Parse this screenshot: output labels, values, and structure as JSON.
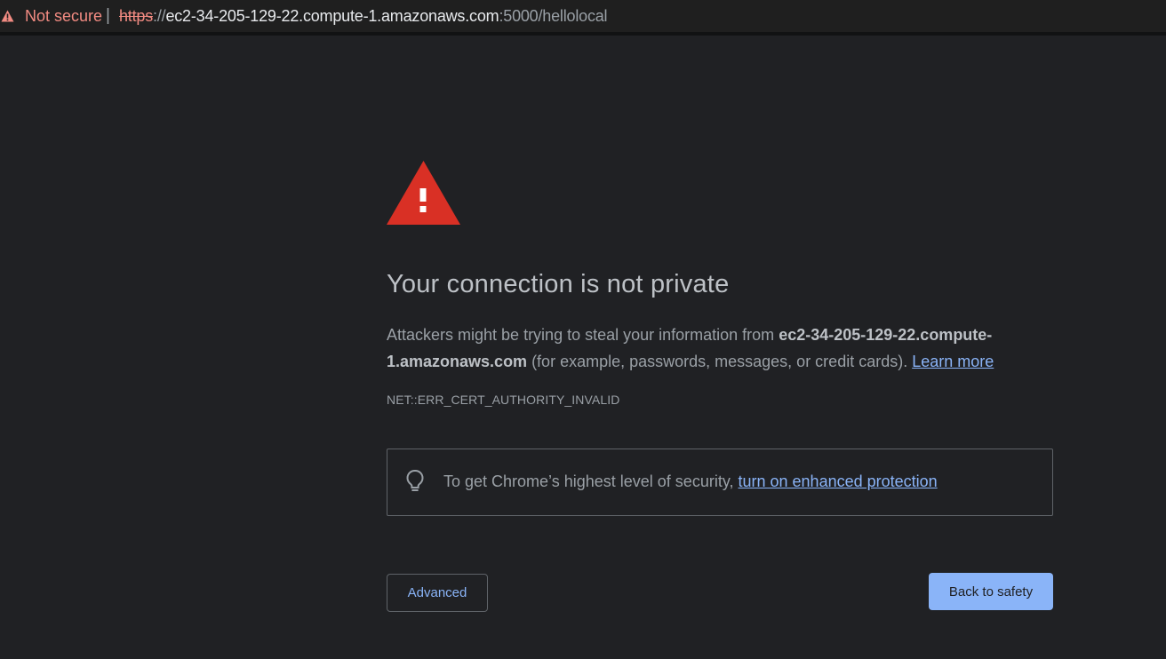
{
  "addressbar": {
    "security_label": "Not secure",
    "separator": "|",
    "url_scheme": "https",
    "url_separator": "://",
    "url_host": "ec2-34-205-129-22.compute-1.amazonaws.com",
    "url_rest": ":5000/hellolocal",
    "warning_icon": "warning-triangle-icon",
    "warning_color": "#f28b82"
  },
  "interstitial": {
    "danger_icon": "danger-triangle-icon",
    "danger_color": "#d93025",
    "heading": "Your connection is not private",
    "explanation_prefix": "Attackers might be trying to steal your information from ",
    "explanation_host": "ec2-34-205-129-22.compute-1.amazonaws.com",
    "explanation_suffix": " (for example, passwords, messages, or credit cards). ",
    "learn_more_link": "Learn more",
    "error_code": "NET::ERR_CERT_AUTHORITY_INVALID",
    "enhanced_protection": {
      "icon": "lightbulb-icon",
      "text": "To get Chrome’s highest level of security, ",
      "link": "turn on enhanced protection"
    },
    "advanced_button": "Advanced",
    "back_button": "Back to safety",
    "accent_color": "#8ab4f8",
    "background_color": "#202124"
  }
}
